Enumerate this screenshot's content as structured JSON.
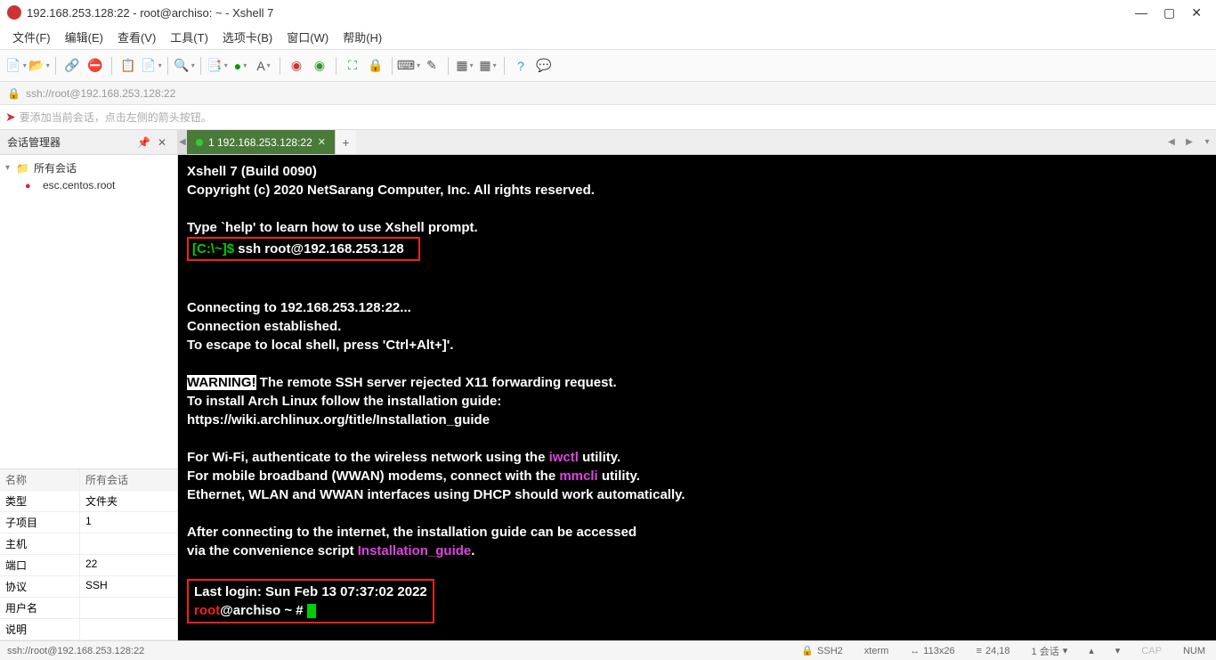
{
  "window": {
    "title": "192.168.253.128:22 - root@archiso: ~ - Xshell 7"
  },
  "menu": [
    "文件(F)",
    "编辑(E)",
    "查看(V)",
    "工具(T)",
    "选项卡(B)",
    "窗口(W)",
    "帮助(H)"
  ],
  "addressBar": "ssh://root@192.168.253.128:22",
  "hint": "要添加当前会话，点击左侧的箭头按钮。",
  "sidebar": {
    "title": "会话管理器",
    "root": "所有会话",
    "item": "esc.centos.root"
  },
  "propsHeader": {
    "name": "名称",
    "value": "所有会话"
  },
  "props": [
    {
      "k": "类型",
      "v": "文件夹"
    },
    {
      "k": "子项目",
      "v": "1"
    },
    {
      "k": "主机",
      "v": ""
    },
    {
      "k": "端口",
      "v": "22"
    },
    {
      "k": "协议",
      "v": "SSH"
    },
    {
      "k": "用户名",
      "v": ""
    },
    {
      "k": "说明",
      "v": ""
    }
  ],
  "tab": {
    "label": "1 192.168.253.128:22"
  },
  "terminal": {
    "l1": "Xshell 7 (Build 0090)",
    "l2": "Copyright (c) 2020 NetSarang Computer, Inc. All rights reserved.",
    "l3": "Type `help' to learn how to use Xshell prompt.",
    "promptLocal": "[C:\\~]$",
    "cmd": "ssh root@192.168.253.128",
    "conn1": "Connecting to 192.168.253.128:22...",
    "conn2": "Connection established.",
    "conn3": "To escape to local shell, press 'Ctrl+Alt+]'.",
    "warn": "WARNING!",
    "warnRest": " The remote SSH server rejected X11 forwarding request.",
    "install1": "To install Arch Linux follow the installation guide:",
    "install2": "https://wiki.archlinux.org/title/Installation_guide",
    "wifi1a": "For Wi-Fi, authenticate to the wireless network using the ",
    "wifi1b": "iwctl",
    "wifi1c": " utility.",
    "wifi2a": "For mobile broadband (WWAN) modems, connect with the ",
    "wifi2b": "mmcli",
    "wifi2c": " utility.",
    "wifi3": "Ethernet, WLAN and WWAN interfaces using DHCP should work automatically.",
    "after1": "After connecting to the internet, the installation guide can be accessed",
    "after2a": "via the convenience script ",
    "after2b": "Installation_guide",
    "after2c": ".",
    "lastlogin": "Last login: Sun Feb 13 07:37:02 2022",
    "rootUser": "root",
    "rootHost": "@archiso ~ # "
  },
  "statusBar": {
    "left": "ssh://root@192.168.253.128:22",
    "ssh": "SSH2",
    "term": "xterm",
    "size": "113x26",
    "pos": "24,18",
    "sess": "1 会话",
    "cap": "CAP",
    "num": "NUM"
  }
}
